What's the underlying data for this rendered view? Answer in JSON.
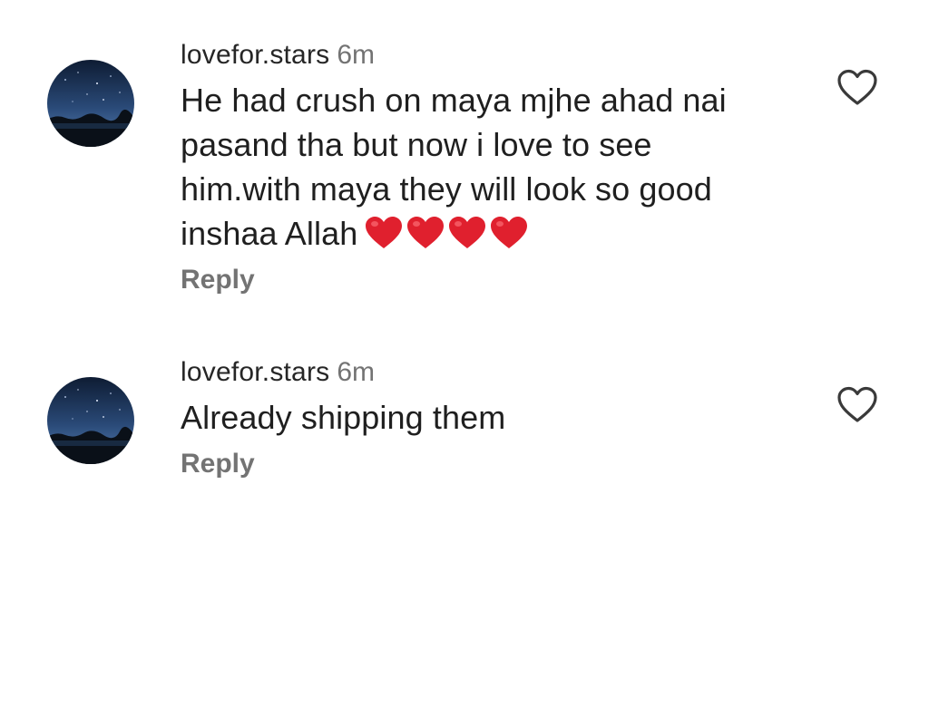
{
  "comments": [
    {
      "username": "lovefor.stars",
      "time": "6m",
      "lines": [
        "He had crush on maya mjhe ahad nai",
        "pasand tha but now i love to see",
        "him.with maya they will look so good",
        "inshaa Allah"
      ],
      "emoji": [
        "red-heart",
        "red-heart",
        "red-heart",
        "red-heart"
      ],
      "reply_label": "Reply",
      "icon": "heart-outline-icon"
    },
    {
      "username": "lovefor.stars",
      "time": "6m",
      "lines": [
        "Already shipping them"
      ],
      "reply_label": "Reply",
      "icon": "heart-outline-icon"
    }
  ],
  "colors": {
    "username": "#262626",
    "secondary": "#737373",
    "heart_emoji": "#e0202e"
  }
}
